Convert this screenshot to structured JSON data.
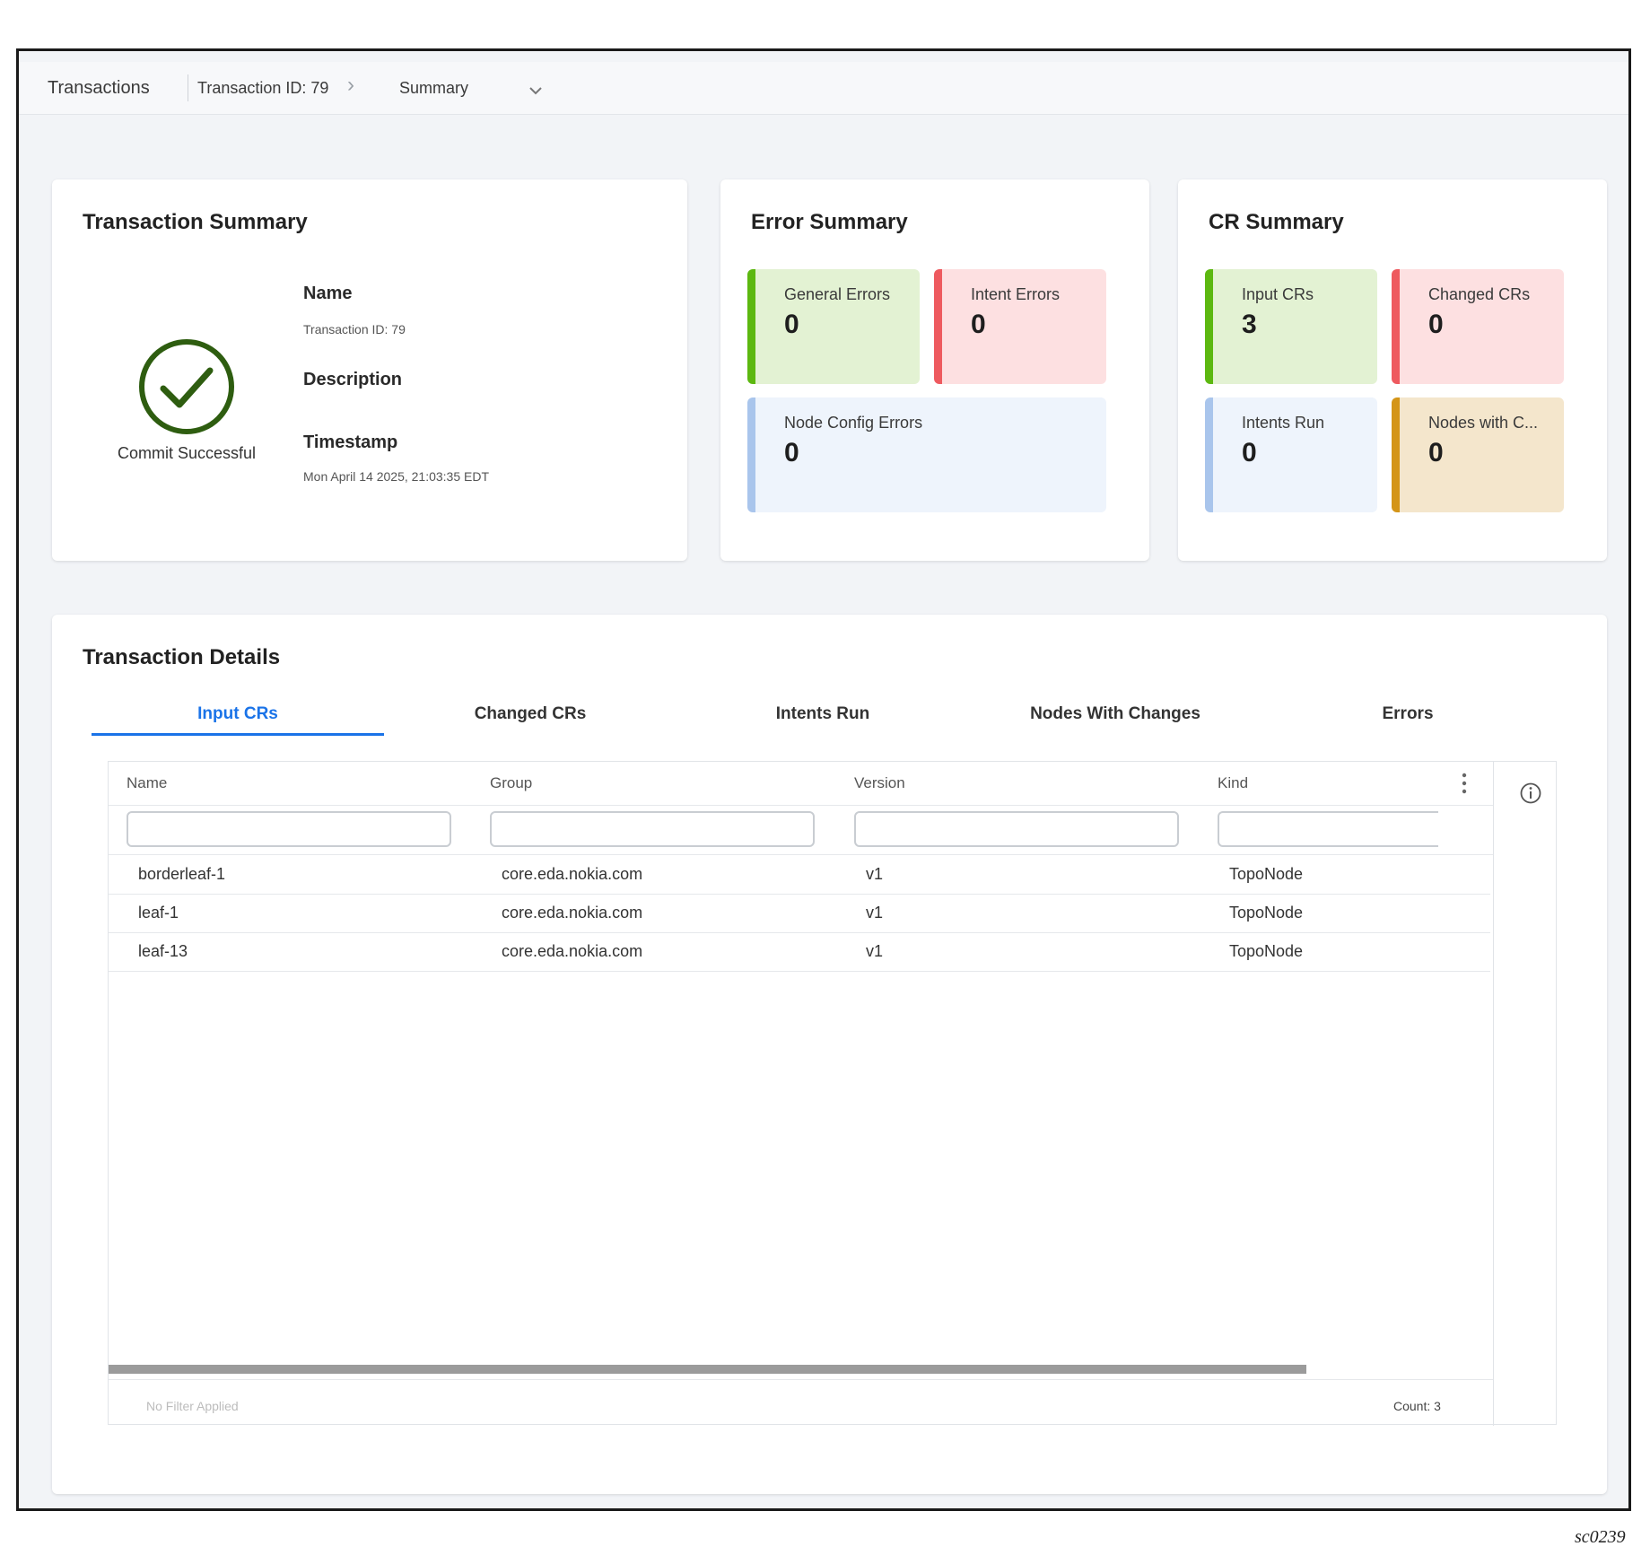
{
  "breadcrumb": {
    "root": "Transactions",
    "transaction": "Transaction ID: 79",
    "view": "Summary"
  },
  "transaction_summary": {
    "title": "Transaction Summary",
    "status": "Commit Successful",
    "name_label": "Name",
    "name_value": "Transaction ID: 79",
    "description_label": "Description",
    "timestamp_label": "Timestamp",
    "timestamp_value": "Mon April 14 2025, 21:03:35 EDT"
  },
  "error_summary": {
    "title": "Error Summary",
    "tiles": [
      {
        "label": "General Errors",
        "value": "0",
        "color": "#5cb810"
      },
      {
        "label": "Intent Errors",
        "value": "0",
        "color": "#ee5a5f"
      },
      {
        "label": "Node Config Errors",
        "value": "0",
        "color": "#a9c5ec"
      }
    ]
  },
  "cr_summary": {
    "title": "CR Summary",
    "tiles": [
      {
        "label": "Input CRs",
        "value": "3",
        "color": "#5cb810"
      },
      {
        "label": "Changed CRs",
        "value": "0",
        "color": "#ee5a5f"
      },
      {
        "label": "Intents Run",
        "value": "0",
        "color": "#a9c5ec"
      },
      {
        "label": "Nodes with C...",
        "value": "0",
        "color": "#d49518"
      }
    ]
  },
  "details": {
    "title": "Transaction Details",
    "tabs": [
      "Input CRs",
      "Changed CRs",
      "Intents Run",
      "Nodes With Changes",
      "Errors"
    ],
    "active_tab": "Input CRs",
    "columns": [
      "Name",
      "Group",
      "Version",
      "Kind"
    ],
    "rows": [
      [
        "borderleaf-1",
        "core.eda.nokia.com",
        "v1",
        "TopoNode"
      ],
      [
        "leaf-1",
        "core.eda.nokia.com",
        "v1",
        "TopoNode"
      ],
      [
        "leaf-13",
        "core.eda.nokia.com",
        "v1",
        "TopoNode"
      ]
    ],
    "footer_filter": "No Filter Applied",
    "footer_count": "Count: 3"
  },
  "figure_label": "sc0239",
  "colors": {
    "accent": "#1a73e8",
    "success": "#2e5d10"
  }
}
